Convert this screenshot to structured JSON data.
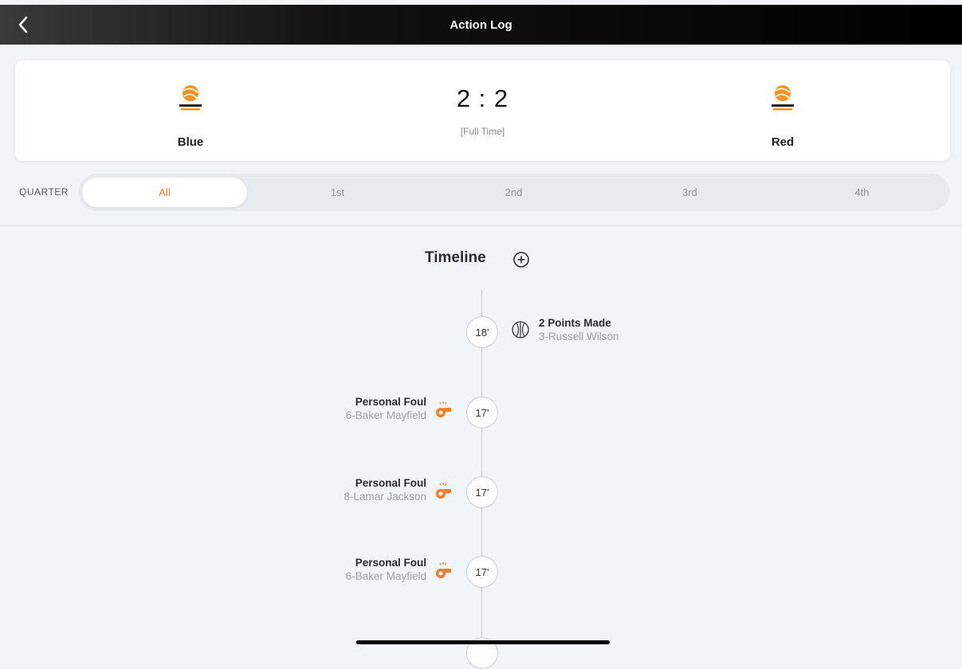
{
  "header": {
    "title": "Action Log"
  },
  "scorecard": {
    "home": {
      "name": "Blue"
    },
    "away": {
      "name": "Red"
    },
    "score": "2 : 2",
    "status": "[Full Time]"
  },
  "quarter": {
    "label": "QUARTER",
    "tabs": [
      {
        "label": "All",
        "active": true
      },
      {
        "label": "1st",
        "active": false
      },
      {
        "label": "2nd",
        "active": false
      },
      {
        "label": "3rd",
        "active": false
      },
      {
        "label": "4th",
        "active": false
      }
    ]
  },
  "timeline": {
    "title": "Timeline",
    "events": [
      {
        "time": "18'",
        "title": "2 Points Made",
        "player": "3-Russell Wilson",
        "side": "right",
        "icon": "basketball-icon"
      },
      {
        "time": "17'",
        "title": "Personal Foul",
        "player": "6-Baker Mayfield",
        "side": "left",
        "icon": "whistle-icon"
      },
      {
        "time": "17'",
        "title": "Personal Foul",
        "player": "8-Lamar Jackson",
        "side": "left",
        "icon": "whistle-icon"
      },
      {
        "time": "17'",
        "title": "Personal Foul",
        "player": "6-Baker Mayfield",
        "side": "left",
        "icon": "whistle-icon"
      }
    ]
  },
  "colors": {
    "accent": "#ff7a1a",
    "header_bg": "#000000",
    "background": "#f2f5f8"
  }
}
